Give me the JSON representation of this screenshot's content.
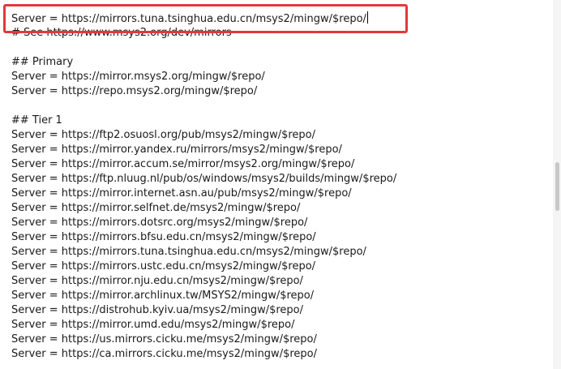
{
  "editor": {
    "lines": [
      "Server = https://mirrors.tuna.tsinghua.edu.cn/msys2/mingw/$repo/",
      "# See https://www.msys2.org/dev/mirrors",
      "",
      "## Primary",
      "Server = https://mirror.msys2.org/mingw/$repo/",
      "Server = https://repo.msys2.org/mingw/$repo/",
      "",
      "## Tier 1",
      "Server = https://ftp2.osuosl.org/pub/msys2/mingw/$repo/",
      "Server = https://mirror.yandex.ru/mirrors/msys2/mingw/$repo/",
      "Server = https://mirror.accum.se/mirror/msys2.org/mingw/$repo/",
      "Server = https://ftp.nluug.nl/pub/os/windows/msys2/builds/mingw/$repo/",
      "Server = https://mirror.internet.asn.au/pub/msys2/mingw/$repo/",
      "Server = https://mirror.selfnet.de/msys2/mingw/$repo/",
      "Server = https://mirrors.dotsrc.org/msys2/mingw/$repo/",
      "Server = https://mirrors.bfsu.edu.cn/msys2/mingw/$repo/",
      "Server = https://mirrors.tuna.tsinghua.edu.cn/msys2/mingw/$repo/",
      "Server = https://mirrors.ustc.edu.cn/msys2/mingw/$repo/",
      "Server = https://mirror.nju.edu.cn/msys2/mingw/$repo/",
      "Server = https://mirror.archlinux.tw/MSYS2/mingw/$repo/",
      "Server = https://distrohub.kyiv.ua/msys2/mingw/$repo/",
      "Server = https://mirror.umd.edu/msys2/mingw/$repo/",
      "Server = https://us.mirrors.cicku.me/msys2/mingw/$repo/",
      "Server = https://ca.mirrors.cicku.me/msys2/mingw/$repo/"
    ]
  },
  "annotation": {
    "color": "#e0393e"
  }
}
